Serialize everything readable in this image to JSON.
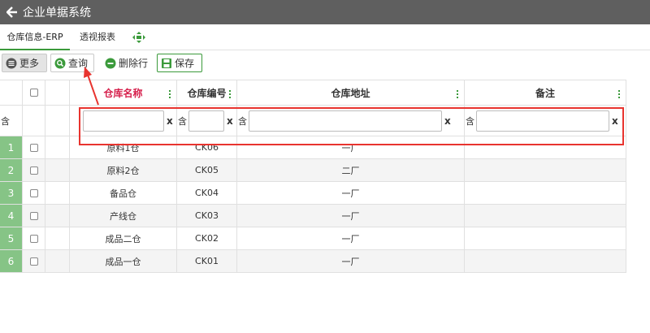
{
  "app": {
    "title": "企业单据系统"
  },
  "tabs": [
    {
      "label": "仓库信息-ERP",
      "active": true
    },
    {
      "label": "透视报表",
      "active": false
    }
  ],
  "toolbar": {
    "more_label": "更多",
    "query_label": "查询",
    "delete_label": "删除行",
    "save_label": "保存"
  },
  "table": {
    "columns": [
      "仓库名称",
      "仓库编号",
      "仓库地址",
      "备注"
    ],
    "filter": {
      "contains_label": "含",
      "clear_label": "x",
      "values": [
        "",
        "",
        "",
        ""
      ]
    },
    "rows": [
      {
        "num": "1",
        "name": "原料1仓",
        "code": "CK06",
        "address": "一厂",
        "note": ""
      },
      {
        "num": "2",
        "name": "原料2仓",
        "code": "CK05",
        "address": "二厂",
        "note": ""
      },
      {
        "num": "3",
        "name": "备品仓",
        "code": "CK04",
        "address": "一厂",
        "note": ""
      },
      {
        "num": "4",
        "name": "产线仓",
        "code": "CK03",
        "address": "一厂",
        "note": ""
      },
      {
        "num": "5",
        "name": "成品二仓",
        "code": "CK02",
        "address": "一厂",
        "note": ""
      },
      {
        "num": "6",
        "name": "成品一仓",
        "code": "CK01",
        "address": "一厂",
        "note": ""
      }
    ]
  },
  "colors": {
    "accent": "#3b9a3b",
    "title_bar": "#5f5f5f",
    "highlight": "#e8342f",
    "name_header": "#d6204c",
    "row_number": "#86c486"
  },
  "icons": {
    "back": "arrow-left-icon",
    "move": "move-arrows-icon",
    "more": "list-icon",
    "query": "search-icon",
    "delete": "minus-circle-icon",
    "save": "save-icon",
    "column_menu": "dots-vertical-icon"
  }
}
